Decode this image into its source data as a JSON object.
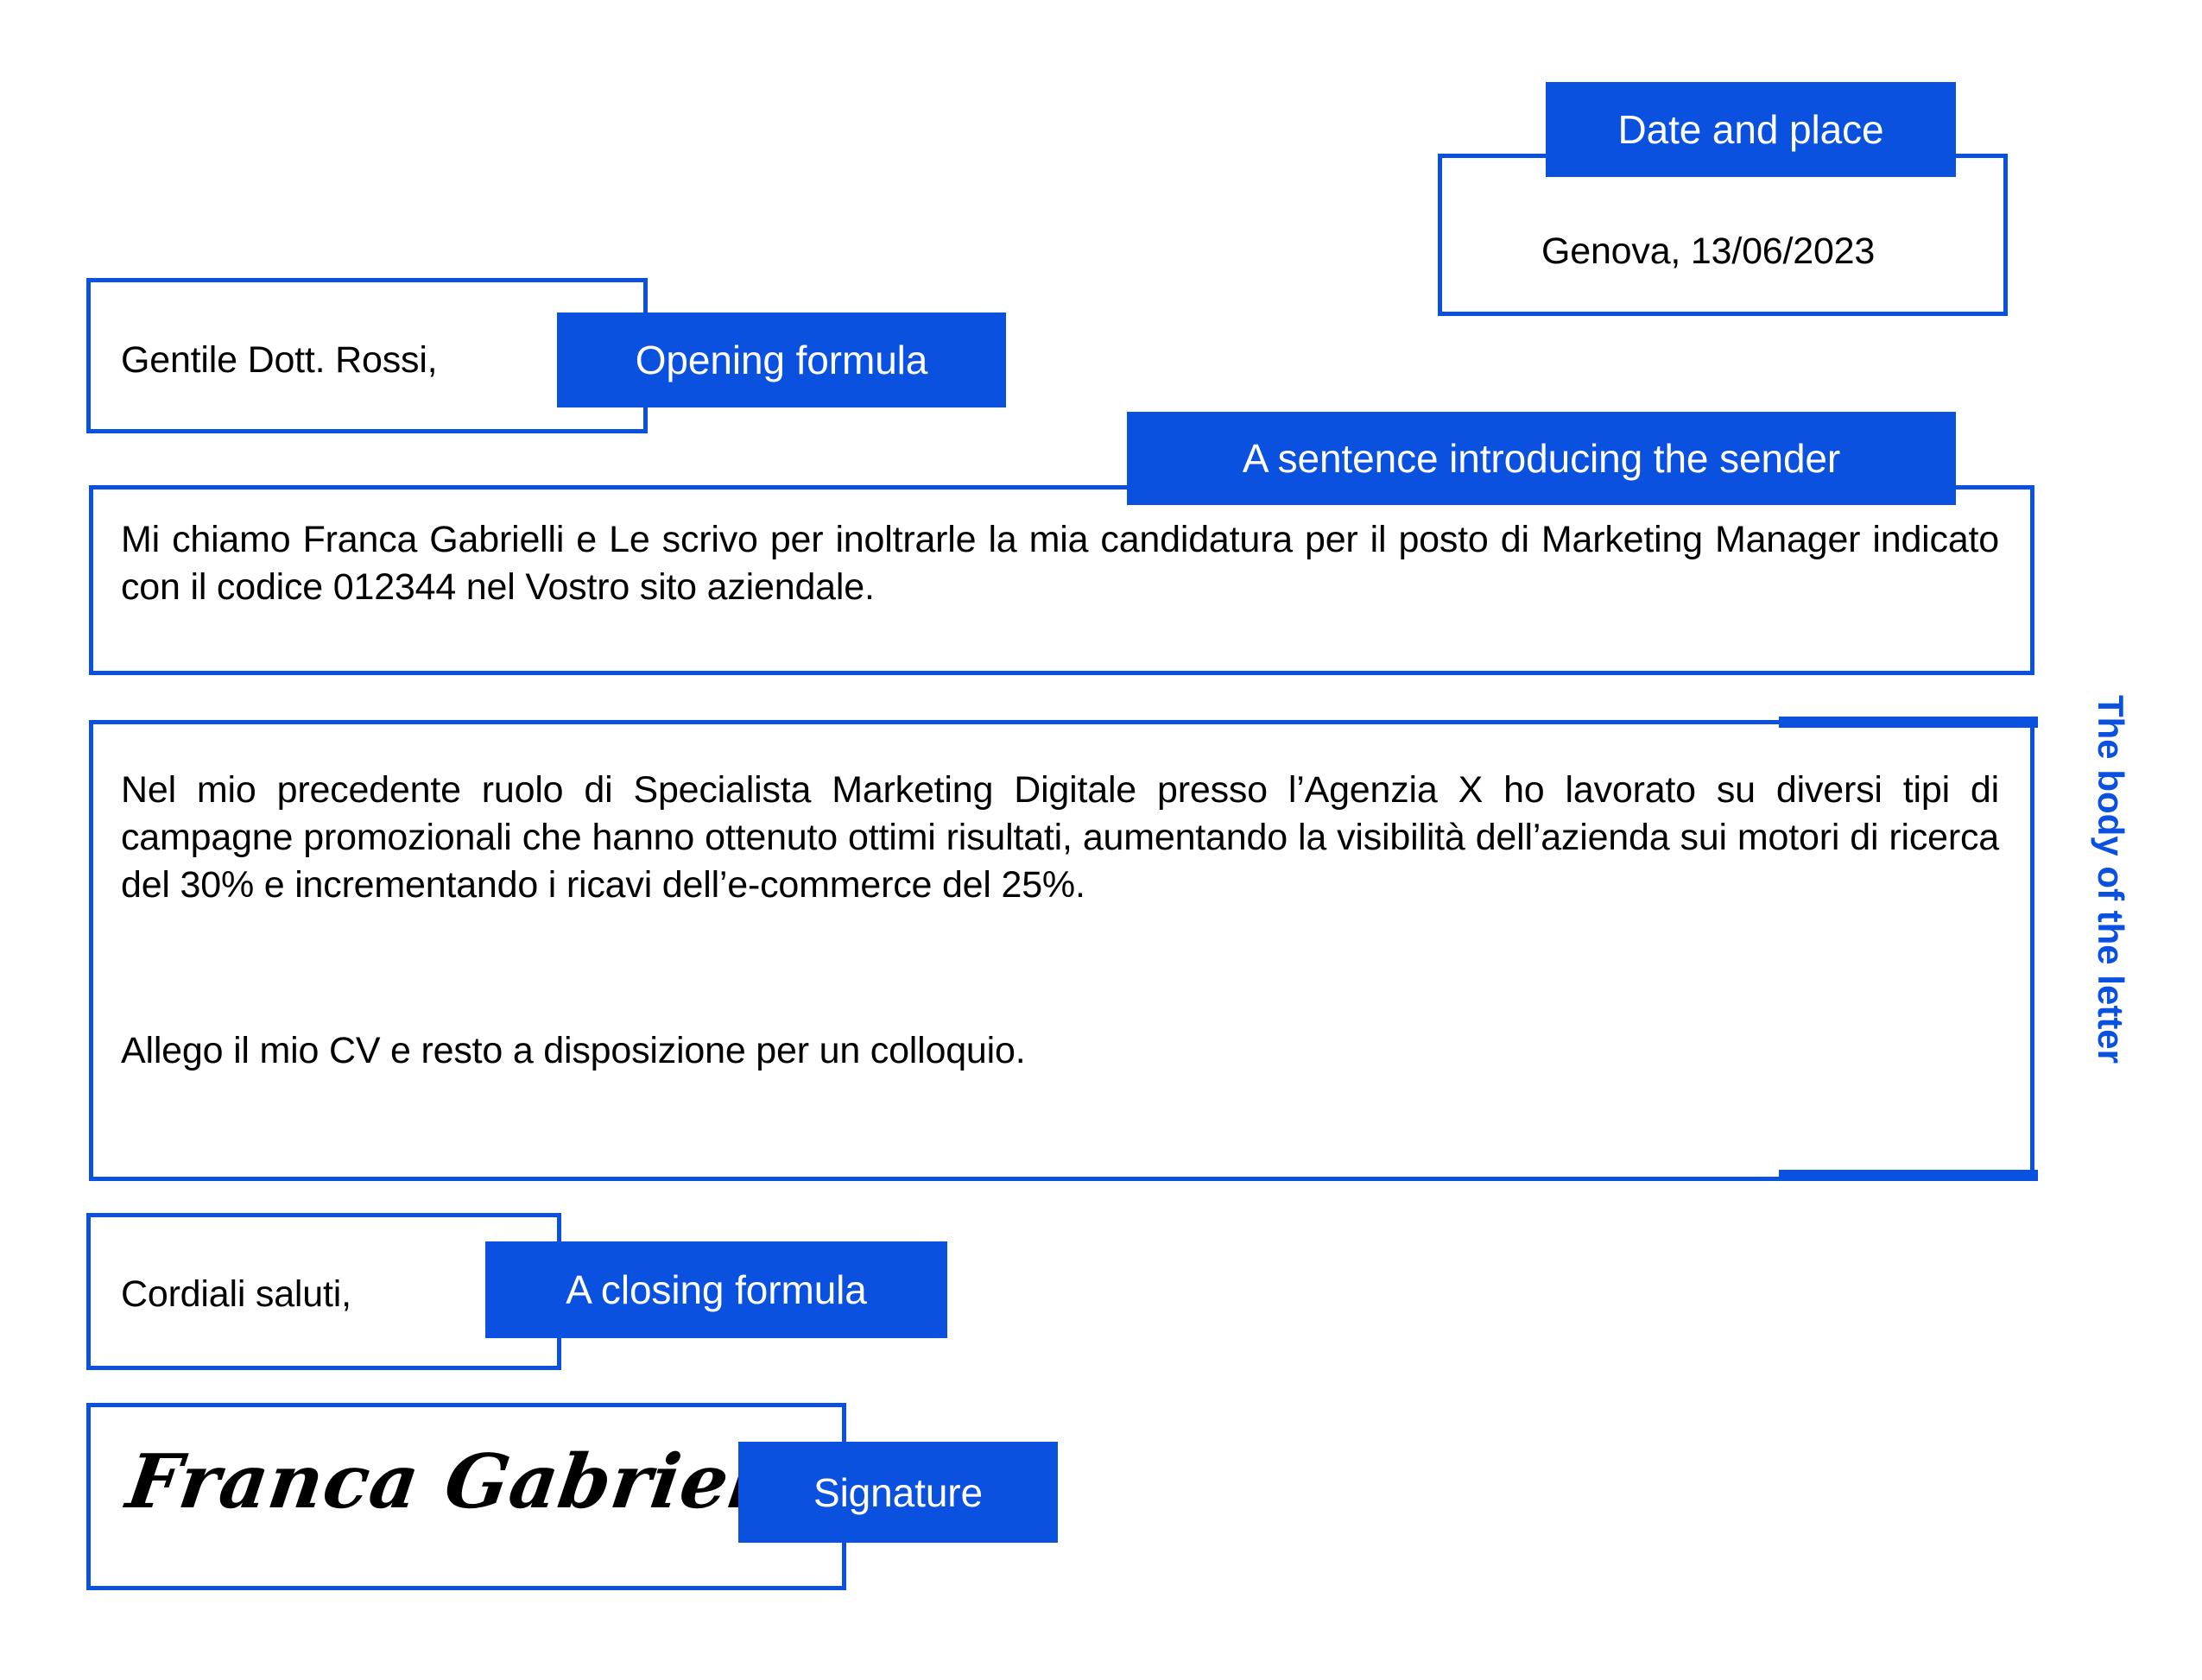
{
  "colors": {
    "accent": "#0a51e0",
    "text": "#000000",
    "background": "#ffffff"
  },
  "annotations": {
    "date_and_place": "Date and place",
    "opening_formula": "Opening formula",
    "sentence_introducing_sender": "A sentence introducing the sender",
    "body_of_the_letter": "The body of the letter",
    "closing_formula": "A closing formula",
    "signature": "Signature"
  },
  "letter": {
    "date_place": "Genova, 13/06/2023",
    "salutation": "Gentile Dott. Rossi,",
    "intro_paragraph": "Mi chiamo Franca Gabrielli e Le scrivo per inoltrarle la mia candidatura per il posto di Marketing Manager indicato con il codice 012344 nel Vostro sito aziendale.",
    "body_paragraph_1": "Nel mio precedente ruolo di Specialista Marketing Digitale presso l’Agenzia X ho lavorato su diversi tipi di campagne promozionali che hanno ottenuto ottimi risultati, aumentando la visibilità dell’azienda sui motori di ricerca del 30% e incrementando i ricavi dell’e-commerce del 25%.",
    "body_paragraph_2": "Allego il mio CV e resto a disposizione per un colloquio.",
    "closing": "Cordiali saluti,",
    "signature_name": "Franca Gabrielli"
  }
}
